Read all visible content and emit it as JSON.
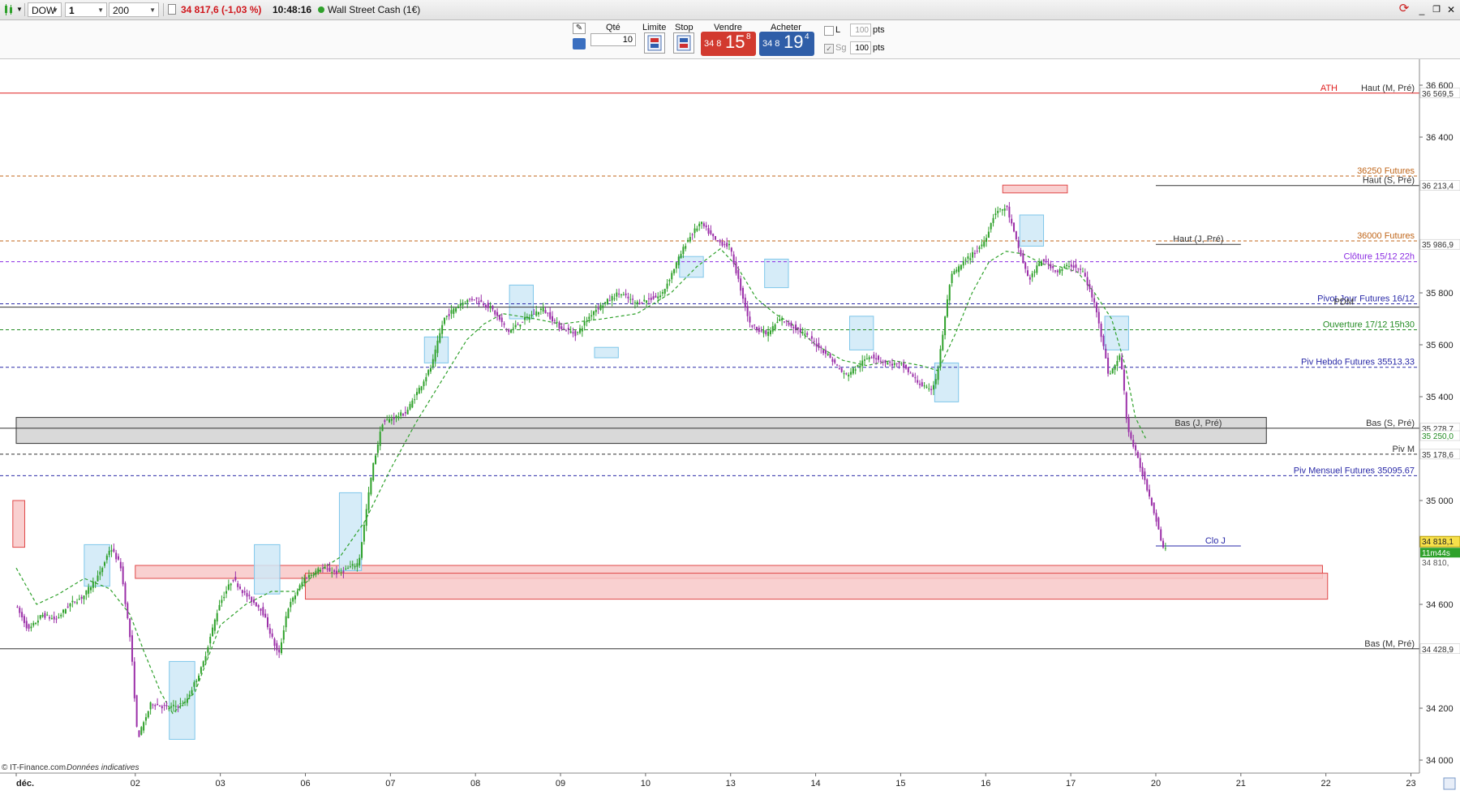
{
  "toolbar": {
    "symbol": "DOW",
    "timeframe": "1 heure",
    "units": "200 unités",
    "price_change": "34 817,6 (-1,03 %)",
    "time": "10:48:16",
    "instrument": "Wall Street Cash (1€)"
  },
  "order_bar": {
    "qty_label": "Qté",
    "qty_value": "10",
    "limit_label": "Limite",
    "stop_label": "Stop",
    "sell_label": "Vendre",
    "sell_prefix": "34 8",
    "sell_big": "15",
    "sell_dec": "8",
    "buy_label": "Acheter",
    "buy_prefix": "34 8",
    "buy_big": "19",
    "buy_dec": "4",
    "l_label": "L",
    "l_value": "100",
    "sg_label": "Sg",
    "sg_value": "100",
    "pts": "pts"
  },
  "footer": {
    "credit": "© IT-Finance.com",
    "note": "Données indicatives"
  },
  "colors": {
    "up": "#2fa12b",
    "down": "#9b2fa8",
    "ath": "#e02020",
    "orange": "#c0661a",
    "purple": "#8a2be2",
    "navy": "#2a2aa8",
    "green": "#228b22"
  },
  "chart_data": {
    "type": "candlestick",
    "symbol": "DOW",
    "interval": "1 heure",
    "ylim": [
      33950,
      36700
    ],
    "y_ticks": [
      {
        "value": 36600,
        "label": "36 600"
      },
      {
        "value": 36400,
        "label": "36 400"
      },
      {
        "value": 35800,
        "label": "35 800"
      },
      {
        "value": 35600,
        "label": "35 600"
      },
      {
        "value": 35400,
        "label": "35 400"
      },
      {
        "value": 35000,
        "label": "35 000"
      },
      {
        "value": 34600,
        "label": "34 600"
      },
      {
        "value": 34200,
        "label": "34 200"
      },
      {
        "value": 34000,
        "label": "34 000"
      }
    ],
    "x_ticks": [
      {
        "label": "déc.",
        "t": 0
      },
      {
        "label": "02",
        "t": 7
      },
      {
        "label": "03",
        "t": 12
      },
      {
        "label": "06",
        "t": 17
      },
      {
        "label": "07",
        "t": 22
      },
      {
        "label": "08",
        "t": 27
      },
      {
        "label": "09",
        "t": 32
      },
      {
        "label": "10",
        "t": 37
      },
      {
        "label": "13",
        "t": 42
      },
      {
        "label": "14",
        "t": 47
      },
      {
        "label": "15",
        "t": 52
      },
      {
        "label": "16",
        "t": 57
      },
      {
        "label": "17",
        "t": 62
      },
      {
        "label": "20",
        "t": 67
      },
      {
        "label": "21",
        "t": 72
      },
      {
        "label": "22",
        "t": 77
      },
      {
        "label": "23",
        "t": 82
      }
    ],
    "x_max": 82.5,
    "price_path": [
      [
        0,
        34600
      ],
      [
        0.8,
        34500
      ],
      [
        1.6,
        34560
      ],
      [
        2.4,
        34540
      ],
      [
        3.2,
        34600
      ],
      [
        4,
        34630
      ],
      [
        5,
        34720
      ],
      [
        5.6,
        34820
      ],
      [
        6.2,
        34750
      ],
      [
        6.8,
        34450
      ],
      [
        7.2,
        34080
      ],
      [
        8,
        34220
      ],
      [
        9,
        34200
      ],
      [
        10,
        34220
      ],
      [
        11,
        34360
      ],
      [
        12,
        34600
      ],
      [
        12.8,
        34700
      ],
      [
        13.5,
        34640
      ],
      [
        14.5,
        34580
      ],
      [
        15.5,
        34400
      ],
      [
        16,
        34580
      ],
      [
        17,
        34700
      ],
      [
        18,
        34740
      ],
      [
        19,
        34720
      ],
      [
        20.2,
        34760
      ],
      [
        21,
        35120
      ],
      [
        21.6,
        35300
      ],
      [
        23,
        35340
      ],
      [
        24.5,
        35520
      ],
      [
        25.2,
        35700
      ],
      [
        26.2,
        35760
      ],
      [
        27,
        35780
      ],
      [
        28,
        35740
      ],
      [
        29,
        35650
      ],
      [
        30,
        35700
      ],
      [
        31,
        35740
      ],
      [
        32,
        35670
      ],
      [
        33,
        35640
      ],
      [
        34,
        35730
      ],
      [
        35.5,
        35800
      ],
      [
        36.5,
        35760
      ],
      [
        38,
        35790
      ],
      [
        39.5,
        36000
      ],
      [
        40.3,
        36070
      ],
      [
        41.2,
        36000
      ],
      [
        42,
        35980
      ],
      [
        42.8,
        35780
      ],
      [
        43.2,
        35680
      ],
      [
        44.2,
        35640
      ],
      [
        45,
        35700
      ],
      [
        46,
        35660
      ],
      [
        46.8,
        35620
      ],
      [
        47.8,
        35560
      ],
      [
        48.8,
        35480
      ],
      [
        49.6,
        35520
      ],
      [
        50.3,
        35560
      ],
      [
        51.2,
        35530
      ],
      [
        52.2,
        35520
      ],
      [
        53,
        35460
      ],
      [
        53.8,
        35420
      ],
      [
        54.2,
        35480
      ],
      [
        55,
        35860
      ],
      [
        55.8,
        35920
      ],
      [
        56.5,
        35960
      ],
      [
        57,
        36000
      ],
      [
        57.6,
        36110
      ],
      [
        58.3,
        36130
      ],
      [
        58.9,
        35990
      ],
      [
        59.6,
        35850
      ],
      [
        60.4,
        35930
      ],
      [
        61.3,
        35880
      ],
      [
        62,
        35910
      ],
      [
        62.8,
        35880
      ],
      [
        63.6,
        35730
      ],
      [
        64.3,
        35480
      ],
      [
        65,
        35560
      ],
      [
        65.4,
        35280
      ],
      [
        65.8,
        35200
      ],
      [
        66.4,
        35080
      ],
      [
        67,
        34950
      ],
      [
        67.5,
        34818
      ]
    ],
    "moving_average_path": [
      [
        0,
        34740
      ],
      [
        1.2,
        34600
      ],
      [
        2.5,
        34640
      ],
      [
        4,
        34700
      ],
      [
        5.5,
        34660
      ],
      [
        6.7,
        34560
      ],
      [
        7.5,
        34420
      ],
      [
        8.5,
        34260
      ],
      [
        9.2,
        34180
      ],
      [
        10.5,
        34260
      ],
      [
        12,
        34520
      ],
      [
        13.5,
        34600
      ],
      [
        15,
        34650
      ],
      [
        16.5,
        34650
      ],
      [
        17.6,
        34720
      ],
      [
        19,
        34780
      ],
      [
        20.5,
        34920
      ],
      [
        22,
        35120
      ],
      [
        23.5,
        35300
      ],
      [
        25,
        35460
      ],
      [
        26.5,
        35620
      ],
      [
        27.5,
        35680
      ],
      [
        28.6,
        35720
      ],
      [
        30.5,
        35700
      ],
      [
        32,
        35680
      ],
      [
        34.5,
        35700
      ],
      [
        36.5,
        35720
      ],
      [
        38.5,
        35800
      ],
      [
        40,
        35900
      ],
      [
        41.4,
        35970
      ],
      [
        42.4,
        35900
      ],
      [
        43.5,
        35780
      ],
      [
        44.6,
        35720
      ],
      [
        45.6,
        35680
      ],
      [
        47,
        35600
      ],
      [
        48.6,
        35540
      ],
      [
        50,
        35520
      ],
      [
        51.5,
        35540
      ],
      [
        53.2,
        35520
      ],
      [
        54.2,
        35500
      ],
      [
        55.2,
        35640
      ],
      [
        56.2,
        35800
      ],
      [
        57.2,
        35920
      ],
      [
        58.2,
        35960
      ],
      [
        59.2,
        35950
      ],
      [
        60.4,
        35910
      ],
      [
        61.4,
        35900
      ],
      [
        62.4,
        35880
      ],
      [
        63.4,
        35800
      ],
      [
        64.4,
        35700
      ],
      [
        65.2,
        35520
      ],
      [
        65.8,
        35320
      ],
      [
        66.4,
        35240
      ]
    ],
    "current_price": {
      "value": 34818,
      "label": "34 818,1"
    },
    "countdown_label": "11m44s",
    "current_price_secondary": "34 810,",
    "levels": [
      {
        "name": "ATH",
        "value": 36569.5,
        "style": "solid",
        "color_key": "ath",
        "price_label": "36 569,5",
        "labels": [
          {
            "text": "ATH",
            "color_key": "ath",
            "offset": 95
          },
          {
            "text": "Haut (M, Pré)",
            "color_key": "dark",
            "offset": 0
          }
        ]
      },
      {
        "value": 36250,
        "style": "dashed",
        "color_key": "orange",
        "labels": [
          {
            "text": "36250 Futures",
            "color_key": "orange",
            "offset": 0
          }
        ]
      },
      {
        "value": 36213.4,
        "style": "solid-partial",
        "color_key": "dark",
        "price_label": "36 213,4",
        "from_t": 67,
        "labels": [
          {
            "text": "Haut (S, Pré)",
            "color_key": "dark",
            "offset": 0
          }
        ]
      },
      {
        "value": 36000,
        "style": "dashed",
        "color_key": "orange",
        "labels": [
          {
            "text": "36000 Futures",
            "color_key": "orange",
            "offset": 0
          }
        ]
      },
      {
        "value": 35986.9,
        "style": "solid-partial",
        "color_key": "dark",
        "price_label": "35 986,9",
        "from_t": 67,
        "to_t": 72,
        "labels": [
          {
            "text": "Haut (J, Pré)",
            "color_key": "dark",
            "at_t": 69.5
          }
        ]
      },
      {
        "value": 35920,
        "style": "dashed",
        "color_key": "purple",
        "labels": [
          {
            "text": "Clôture 15/12 22h",
            "color_key": "purple",
            "offset": 0
          }
        ]
      },
      {
        "value": 35758,
        "style": "dashed",
        "color_key": "navy",
        "labels": [
          {
            "text": "Pivot Jour Futures 16/12",
            "color_key": "navy",
            "offset": 0
          }
        ]
      },
      {
        "value": 35745,
        "style": "solid",
        "color_key": "dark",
        "labels": [
          {
            "text": "PDM",
            "color_key": "dark",
            "offset": 75
          }
        ]
      },
      {
        "value": 35658,
        "style": "dashed",
        "color_key": "green",
        "labels": [
          {
            "text": "Ouverture 17/12 15h30",
            "color_key": "green",
            "offset": 0
          }
        ]
      },
      {
        "value": 35513.33,
        "style": "dashed",
        "color_key": "navy",
        "labels": [
          {
            "text": "Piv Hebdo Futures 35513.33",
            "color_key": "navy",
            "offset": 0
          }
        ]
      },
      {
        "value": 35278.7,
        "style": "solid",
        "color_key": "dark",
        "price_label": "35 278,7",
        "labels": [
          {
            "text": "Bas (S, Pré)",
            "color_key": "dark",
            "offset": 0
          },
          {
            "text": "Bas (J, Pré)",
            "color_key": "dark",
            "at_t": 69.5
          }
        ]
      },
      {
        "value": 35250,
        "style": "none",
        "color_key": "green",
        "price_label": "35 250,0"
      },
      {
        "value": 35178.6,
        "style": "dashed",
        "color_key": "dark",
        "price_label": "35 178,6",
        "labels": [
          {
            "text": "Piv M",
            "color_key": "dark",
            "offset": 0
          }
        ]
      },
      {
        "value": 35095.67,
        "style": "dashed",
        "color_key": "navy",
        "labels": [
          {
            "text": "Piv Mensuel Futures 35095.67",
            "color_key": "navy",
            "offset": 0
          }
        ]
      },
      {
        "value": 34825,
        "style": "solid-partial",
        "color_key": "navy",
        "from_t": 67,
        "to_t": 72,
        "labels": [
          {
            "text": "Clo J",
            "color_key": "navy",
            "at_t": 70.5
          }
        ]
      },
      {
        "value": 34428.9,
        "style": "solid",
        "color_key": "dark",
        "price_label": "34 428,9",
        "labels": [
          {
            "text": "Bas (M, Pré)",
            "color_key": "dark",
            "offset": 0
          }
        ]
      }
    ],
    "zones": [
      {
        "kind": "grey",
        "from_t": 0,
        "to_t": 73.5,
        "y1": 35320,
        "y2": 35220
      },
      {
        "kind": "red",
        "from_t": 7,
        "to_t": 76.8,
        "y1": 34750,
        "y2": 34700
      },
      {
        "kind": "red",
        "from_t": 17,
        "to_t": 77.1,
        "y1": 34720,
        "y2": 34620
      },
      {
        "kind": "red",
        "from_t": -0.2,
        "to_t": 0.5,
        "y1": 35000,
        "y2": 34820
      },
      {
        "kind": "red",
        "from_t": 58,
        "to_t": 61.8,
        "y1": 36215,
        "y2": 36185
      },
      {
        "kind": "blue",
        "from_t": 4,
        "to_t": 5.5,
        "y1": 34830,
        "y2": 34670
      },
      {
        "kind": "blue",
        "from_t": 9,
        "to_t": 10.5,
        "y1": 34380,
        "y2": 34080
      },
      {
        "kind": "blue",
        "from_t": 14,
        "to_t": 15.5,
        "y1": 34830,
        "y2": 34640
      },
      {
        "kind": "blue",
        "from_t": 19,
        "to_t": 20.3,
        "y1": 35030,
        "y2": 34730
      },
      {
        "kind": "blue",
        "from_t": 24,
        "to_t": 25.4,
        "y1": 35630,
        "y2": 35530
      },
      {
        "kind": "blue",
        "from_t": 29,
        "to_t": 30.4,
        "y1": 35830,
        "y2": 35700
      },
      {
        "kind": "blue",
        "from_t": 34,
        "to_t": 35.4,
        "y1": 35590,
        "y2": 35550
      },
      {
        "kind": "blue",
        "from_t": 39,
        "to_t": 40.4,
        "y1": 35940,
        "y2": 35860
      },
      {
        "kind": "blue",
        "from_t": 44,
        "to_t": 45.4,
        "y1": 35930,
        "y2": 35820
      },
      {
        "kind": "blue",
        "from_t": 49,
        "to_t": 50.4,
        "y1": 35710,
        "y2": 35580
      },
      {
        "kind": "blue",
        "from_t": 54,
        "to_t": 55.4,
        "y1": 35530,
        "y2": 35380
      },
      {
        "kind": "blue",
        "from_t": 59,
        "to_t": 60.4,
        "y1": 36100,
        "y2": 35980
      },
      {
        "kind": "blue",
        "from_t": 64,
        "to_t": 65.4,
        "y1": 35710,
        "y2": 35580
      }
    ]
  }
}
